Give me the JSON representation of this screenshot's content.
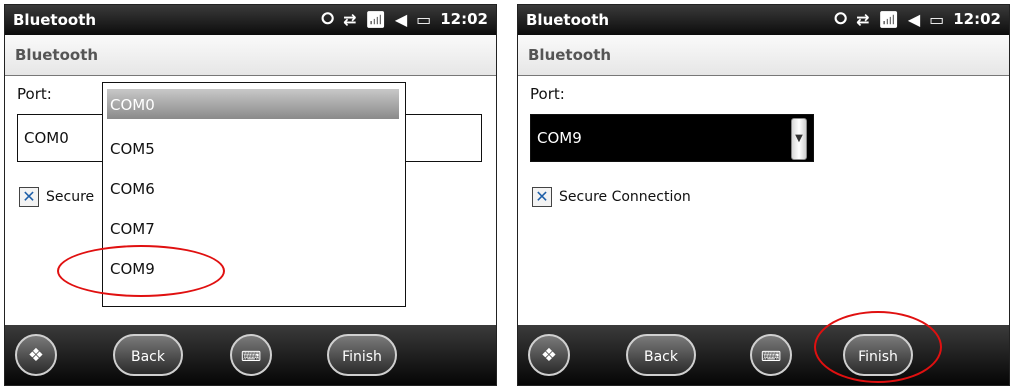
{
  "status_bar": {
    "title": "Bluetooth",
    "clock": "12:02",
    "icons": [
      "bluetooth-icon",
      "sync-icon",
      "signal-off-icon",
      "volume-icon",
      "battery-icon"
    ]
  },
  "subheader": {
    "title": "Bluetooth"
  },
  "left_screen": {
    "port_label": "Port:",
    "combo_value": "COM0",
    "checkbox_label": "Secure",
    "checkbox_checked": true,
    "dropdown_items": [
      "COM0",
      "COM5",
      "COM6",
      "COM7",
      "COM9"
    ],
    "highlighted_item": "COM0"
  },
  "right_screen": {
    "port_label": "Port:",
    "combo_value": "COM9",
    "checkbox_label": "Secure Connection",
    "checkbox_checked": true
  },
  "taskbar": {
    "start_icon": "windows-logo-icon",
    "back_label": "Back",
    "keyboard_icon": "keyboard-icon",
    "finish_label": "Finish"
  },
  "colors": {
    "annotation": "#e01010",
    "bar": "#0c0c0c"
  }
}
